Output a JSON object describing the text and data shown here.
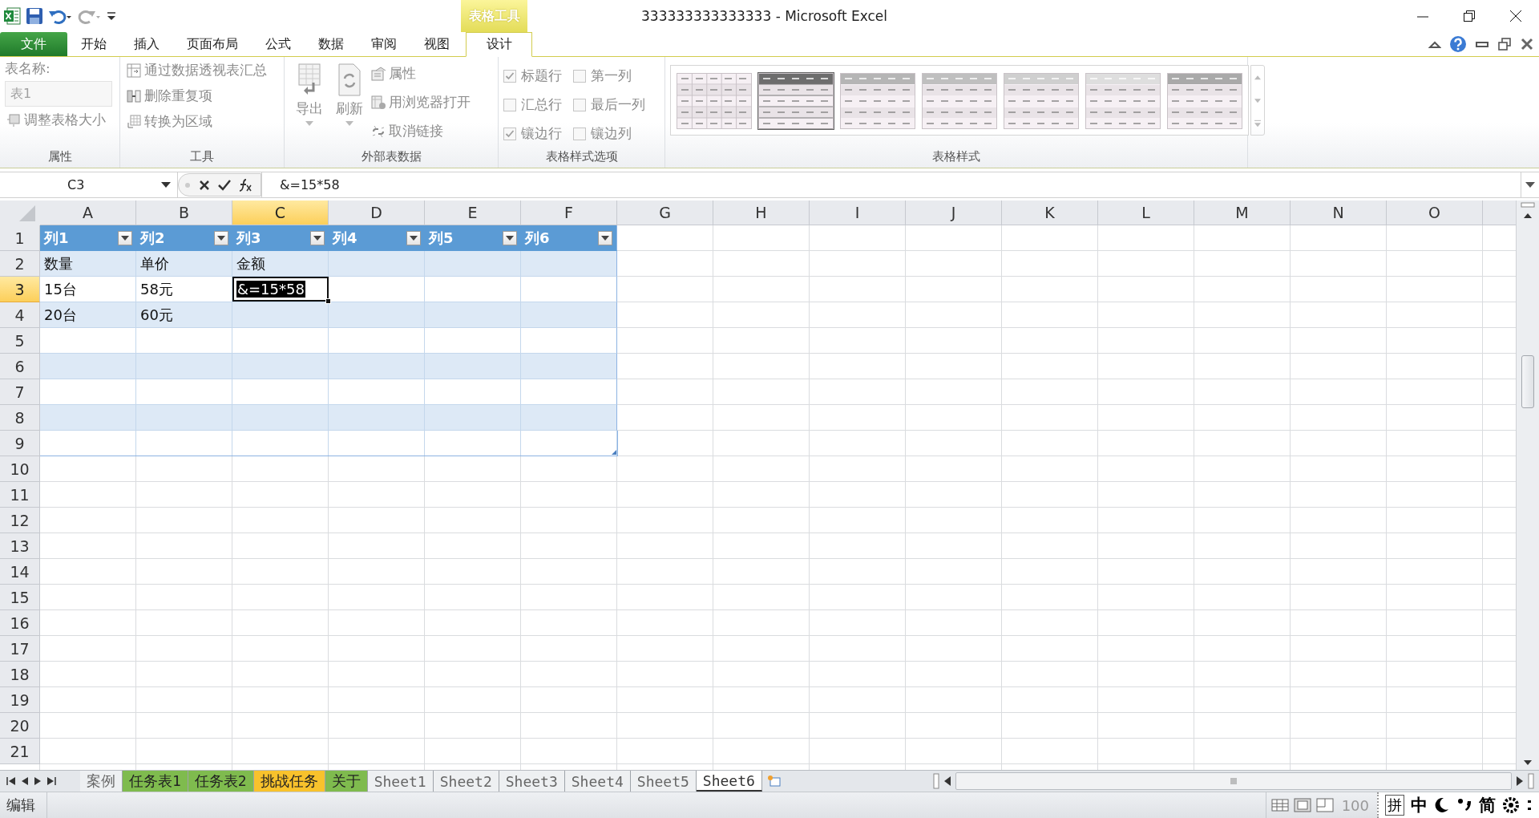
{
  "window": {
    "title": "333333333333333 - Microsoft Excel"
  },
  "contextual_group": {
    "label": "表格工具"
  },
  "ribbon_tabs": [
    {
      "label": "文件",
      "kind": "file",
      "selected": false
    },
    {
      "label": "开始",
      "kind": "tab",
      "selected": false
    },
    {
      "label": "插入",
      "kind": "tab",
      "selected": false
    },
    {
      "label": "页面布局",
      "kind": "tab",
      "selected": false
    },
    {
      "label": "公式",
      "kind": "tab",
      "selected": false
    },
    {
      "label": "数据",
      "kind": "tab",
      "selected": false
    },
    {
      "label": "审阅",
      "kind": "tab",
      "selected": false
    },
    {
      "label": "视图",
      "kind": "tab",
      "selected": false
    },
    {
      "label": "设计",
      "kind": "contextual",
      "selected": true
    }
  ],
  "ribbon": {
    "properties": {
      "name_label": "表名称:",
      "table_name": "表1",
      "resize_button": "调整表格大小",
      "group_label": "属性"
    },
    "tools": {
      "buttons": [
        "通过数据透视表汇总",
        "删除重复项",
        "转换为区域"
      ],
      "group_label": "工具"
    },
    "external_data": {
      "large_buttons": [
        "导出",
        "刷新"
      ],
      "buttons": [
        "属性",
        "用浏览器打开",
        "取消链接"
      ],
      "group_label": "外部表数据"
    },
    "style_options": {
      "options": [
        {
          "label": "标题行",
          "checked": true
        },
        {
          "label": "第一列",
          "checked": false
        },
        {
          "label": "汇总行",
          "checked": false
        },
        {
          "label": "最后一列",
          "checked": false
        },
        {
          "label": "镶边行",
          "checked": true
        },
        {
          "label": "镶边列",
          "checked": false
        }
      ],
      "group_label": "表格样式选项"
    },
    "table_styles": {
      "styles": [
        {
          "selected": false
        },
        {
          "selected": true
        },
        {
          "selected": false
        },
        {
          "selected": false
        },
        {
          "selected": false
        },
        {
          "selected": false
        },
        {
          "selected": false
        }
      ],
      "group_label": "表格样式"
    }
  },
  "formula_bar": {
    "name_box": "C3",
    "formula": "&=15*58"
  },
  "sheet": {
    "columns": [
      {
        "label": "A",
        "selected": false
      },
      {
        "label": "B",
        "selected": false
      },
      {
        "label": "C",
        "selected": true
      },
      {
        "label": "D",
        "selected": false
      },
      {
        "label": "E",
        "selected": false
      },
      {
        "label": "F",
        "selected": false
      },
      {
        "label": "G",
        "selected": false
      },
      {
        "label": "H",
        "selected": false
      },
      {
        "label": "I",
        "selected": false
      },
      {
        "label": "J",
        "selected": false
      },
      {
        "label": "K",
        "selected": false
      },
      {
        "label": "L",
        "selected": false
      },
      {
        "label": "M",
        "selected": false
      },
      {
        "label": "N",
        "selected": false
      },
      {
        "label": "O",
        "selected": false
      }
    ],
    "rows": [
      {
        "label": "1",
        "selected": false
      },
      {
        "label": "2",
        "selected": false
      },
      {
        "label": "3",
        "selected": true
      },
      {
        "label": "4",
        "selected": false
      },
      {
        "label": "5",
        "selected": false
      },
      {
        "label": "6",
        "selected": false
      },
      {
        "label": "7",
        "selected": false
      },
      {
        "label": "8",
        "selected": false
      },
      {
        "label": "9",
        "selected": false
      },
      {
        "label": "10",
        "selected": false
      },
      {
        "label": "11",
        "selected": false
      },
      {
        "label": "12",
        "selected": false
      },
      {
        "label": "13",
        "selected": false
      },
      {
        "label": "14",
        "selected": false
      },
      {
        "label": "15",
        "selected": false
      },
      {
        "label": "16",
        "selected": false
      },
      {
        "label": "17",
        "selected": false
      },
      {
        "label": "18",
        "selected": false
      },
      {
        "label": "19",
        "selected": false
      },
      {
        "label": "20",
        "selected": false
      },
      {
        "label": "21",
        "selected": false
      }
    ]
  },
  "table": {
    "header": [
      "列1",
      "列2",
      "列3",
      "列4",
      "列5",
      "列6"
    ],
    "rows": [
      {
        "banded": true,
        "cells": [
          "数量",
          "单价",
          "金额"
        ]
      },
      {
        "banded": false,
        "cells": [
          "15台",
          "58元",
          "&=15*58"
        ]
      },
      {
        "banded": true,
        "cells": [
          "20台",
          "60元"
        ]
      },
      {
        "banded": false
      },
      {
        "banded": true
      },
      {
        "banded": false
      },
      {
        "banded": true
      },
      {
        "banded": false
      }
    ]
  },
  "sheet_tabs": [
    {
      "label": "案例",
      "selected": false
    },
    {
      "label": "任务表1",
      "color": "#7fbb4e",
      "selected": false
    },
    {
      "label": "任务表2",
      "color": "#7fbb4e",
      "selected": false
    },
    {
      "label": "挑战任务",
      "color": "#f8c22c",
      "selected": false
    },
    {
      "label": "关于",
      "color": "#7fbb4e",
      "selected": false
    },
    {
      "label": "Sheet1",
      "selected": false
    },
    {
      "label": "Sheet2",
      "selected": false
    },
    {
      "label": "Sheet3",
      "selected": false
    },
    {
      "label": "Sheet4",
      "selected": false
    },
    {
      "label": "Sheet5",
      "selected": false
    },
    {
      "label": "Sheet6",
      "selected": true
    }
  ],
  "status_bar": {
    "mode": "编辑",
    "zoom": "100",
    "ime": [
      {
        "kind": "boxed",
        "label": "拼"
      },
      {
        "kind": "text",
        "label": "中"
      },
      {
        "kind": "moon"
      },
      {
        "kind": "punct"
      },
      {
        "kind": "text",
        "label": "简"
      },
      {
        "kind": "gear"
      },
      {
        "kind": "more"
      }
    ]
  }
}
